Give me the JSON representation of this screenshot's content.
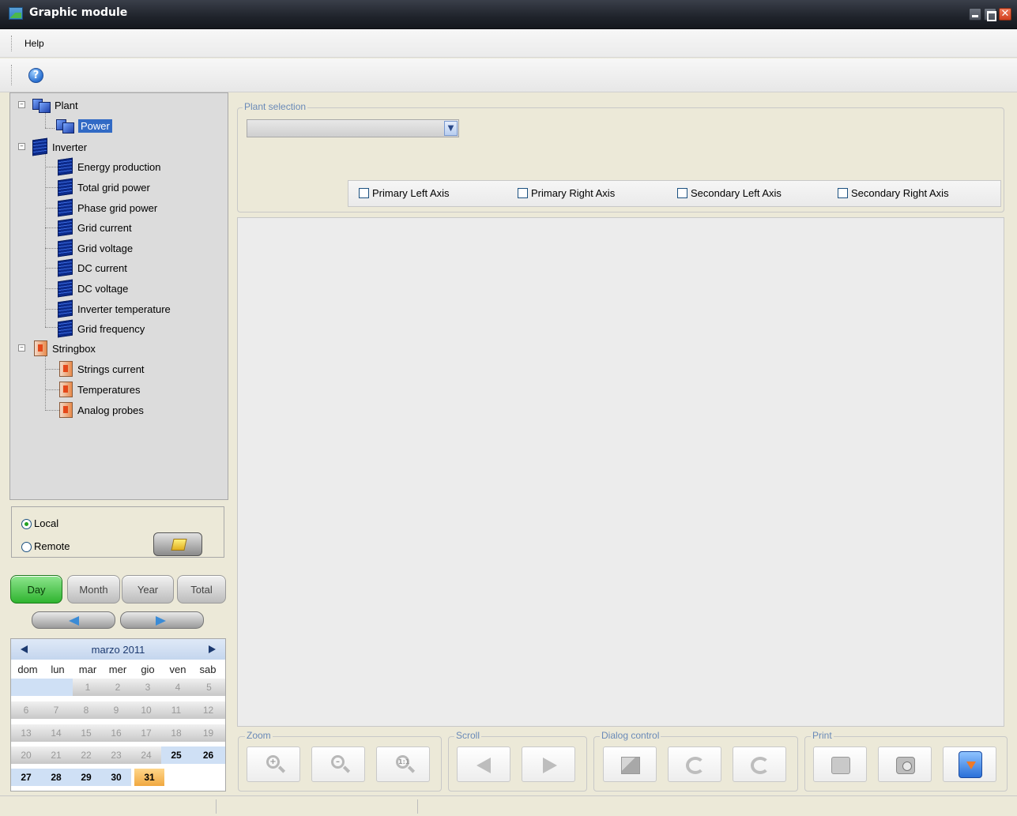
{
  "window": {
    "title": "Graphic module",
    "close_glyph": "✕"
  },
  "menu": {
    "help_label": "Help"
  },
  "toolbar": {
    "help_glyph": "?"
  },
  "tree": {
    "plant": {
      "label": "Plant",
      "children": [
        "Power"
      ]
    },
    "inverter": {
      "label": "Inverter",
      "children": [
        "Energy production",
        "Total grid power",
        "Phase grid power",
        "Grid current",
        "Grid voltage",
        "DC current",
        "DC voltage",
        "Inverter temperature",
        "Grid frequency"
      ]
    },
    "stringbox": {
      "label": "Stringbox",
      "children": [
        "Strings current",
        "Temperatures",
        "Analog probes"
      ]
    },
    "selected": "Power"
  },
  "source": {
    "local_label": "Local",
    "remote_label": "Remote",
    "selected": "Local"
  },
  "period": {
    "day": "Day",
    "month": "Month",
    "year": "Year",
    "total": "Total",
    "active": "Day"
  },
  "calendar": {
    "title": "marzo 2011",
    "weekdays": [
      "dom",
      "lun",
      "mar",
      "mer",
      "gio",
      "ven",
      "sab"
    ],
    "rows": [
      [
        "",
        "",
        "1",
        "2",
        "3",
        "4",
        "5"
      ],
      [
        "6",
        "7",
        "8",
        "9",
        "10",
        "11",
        "12"
      ],
      [
        "13",
        "14",
        "15",
        "16",
        "17",
        "18",
        "19"
      ],
      [
        "20",
        "21",
        "22",
        "23",
        "24",
        "25",
        "26"
      ],
      [
        "27",
        "28",
        "29",
        "30",
        "31",
        "",
        ""
      ]
    ],
    "today": "31"
  },
  "plant_selection": {
    "legend": "Plant selection",
    "value": ""
  },
  "axes": {
    "primary_left": "Primary Left Axis",
    "primary_right": "Primary Right Axis",
    "secondary_left": "Secondary Left Axis",
    "secondary_right": "Secondary Right Axis"
  },
  "groups": {
    "zoom": "Zoom",
    "scroll": "Scroll",
    "dialog": "Dialog control",
    "print": "Print"
  },
  "zoom_reset_glyph": "1:1"
}
